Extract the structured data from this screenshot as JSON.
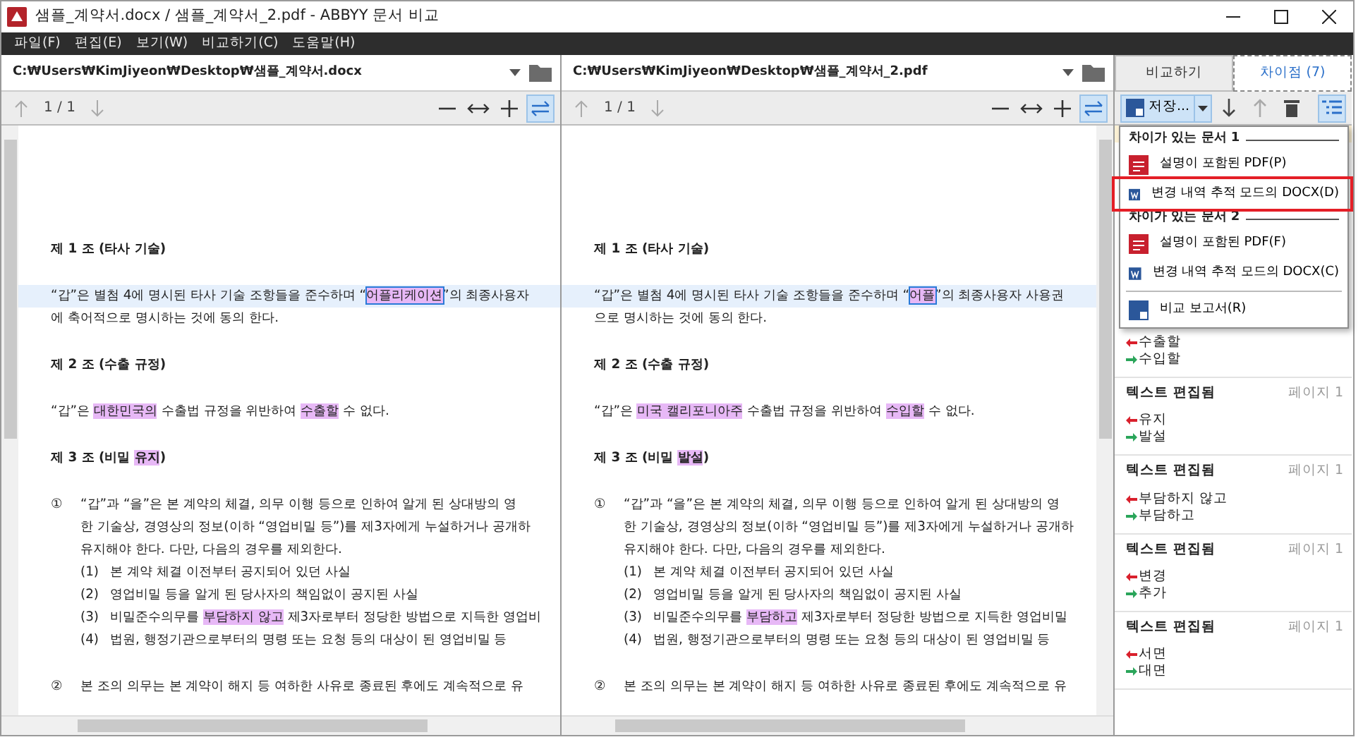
{
  "window": {
    "title": "샘플_계약서.docx / 샘플_계약서_2.pdf - ABBYY 문서 비교"
  },
  "menu": [
    "파일(F)",
    "편집(E)",
    "보기(W)",
    "비교하기(C)",
    "도움말(H)"
  ],
  "documents": [
    {
      "path": "C:₩Users₩KimJiyeon₩Desktop₩샘플_계약서.docx",
      "page": "1 / 1",
      "sync": true,
      "scrollbar_left": true,
      "lines": [
        {
          "kind": "heading",
          "segments": [
            {
              "text": "제 1 조  (타사 기술)"
            }
          ]
        },
        {
          "kind": "para",
          "current": true,
          "segments": [
            {
              "text": "“갑”은 별첨 4에 명시된 타사 기술 조항들을 준수하며 “"
            },
            {
              "text": "어플리케이션",
              "changed": true,
              "focused": true
            },
            {
              "text": "”의 최종사용자"
            }
          ]
        },
        {
          "kind": "cont",
          "segments": [
            {
              "text": "에 축어적으로 명시하는 것에 동의 한다."
            }
          ]
        },
        {
          "kind": "heading",
          "segments": [
            {
              "text": "제 2 조  (수출 규정)"
            }
          ]
        },
        {
          "kind": "para",
          "segments": [
            {
              "text": "“갑”은 "
            },
            {
              "text": "대한민국의",
              "changed": true
            },
            {
              "text": " 수출법 규정을 위반하여 "
            },
            {
              "text": "수출할",
              "changed": true
            },
            {
              "text": " 수 없다."
            }
          ]
        },
        {
          "kind": "heading",
          "segments": [
            {
              "text": "제 3 조  (비밀 "
            },
            {
              "text": "유지",
              "changed": true
            },
            {
              "text": ")"
            }
          ]
        },
        {
          "kind": "item",
          "marker": "①",
          "segments": [
            {
              "text": "“갑”과 “을”은 본 계약의 체결, 의무 이행 등으로 인하여 알게 된 상대방의 영"
            }
          ]
        },
        {
          "kind": "cont",
          "segments": [
            {
              "text": "한 기술상, 경영상의 정보(이하 “영업비밀 등”)를 제3자에게 누설하거나 공개하"
            }
          ]
        },
        {
          "kind": "cont",
          "segments": [
            {
              "text": "유지해야 한다. 다만, 다음의 경우를 제외한다."
            }
          ]
        },
        {
          "kind": "subitem",
          "marker": "(1)",
          "segments": [
            {
              "text": "본 계약 체결 이전부터 공지되어 있던 사실"
            }
          ]
        },
        {
          "kind": "subitem",
          "marker": "(2)",
          "segments": [
            {
              "text": "영업비밀 등을 알게 된 당사자의 책임없이 공지된 사실"
            }
          ]
        },
        {
          "kind": "subitem",
          "marker": "(3)",
          "segments": [
            {
              "text": "비밀준수의무를 "
            },
            {
              "text": "부담하지 않고",
              "changed": true
            },
            {
              "text": " 제3자로부터 정당한 방법으로 지득한 영업비"
            }
          ]
        },
        {
          "kind": "subitem",
          "marker": "(4)",
          "segments": [
            {
              "text": "법원, 행정기관으로부터의 명령 또는 요청 등의 대상이 된 영업비밀 등"
            }
          ]
        },
        {
          "kind": "item",
          "marker": "②",
          "segments": [
            {
              "text": "본 조의 의무는 본 계약이 해지 등 여하한 사유로 종료된 후에도 계속적으로 유"
            }
          ]
        }
      ]
    },
    {
      "path": "C:₩Users₩KimJiyeon₩Desktop₩샘플_계약서_2.pdf",
      "page": "1 / 1",
      "sync": true,
      "scrollbar_left": false,
      "lines": [
        {
          "kind": "heading",
          "segments": [
            {
              "text": "제 1 조  (타사 기술)"
            }
          ]
        },
        {
          "kind": "para",
          "current": true,
          "segments": [
            {
              "text": "“갑”은 별첨 4에 명시된 타사 기술 조항들을 준수하며 “"
            },
            {
              "text": "어플",
              "changed": true,
              "focused": true
            },
            {
              "text": "”의 최종사용자 사용권"
            }
          ]
        },
        {
          "kind": "cont",
          "segments": [
            {
              "text": "으로 명시하는 것에 동의 한다."
            }
          ]
        },
        {
          "kind": "heading",
          "segments": [
            {
              "text": "제 2 조  (수출 규정)"
            }
          ]
        },
        {
          "kind": "para",
          "segments": [
            {
              "text": "“갑”은 "
            },
            {
              "text": "미국 캘리포니아주",
              "changed": true
            },
            {
              "text": " 수출법 규정을 위반하여 "
            },
            {
              "text": "수입할",
              "changed": true
            },
            {
              "text": " 수 없다."
            }
          ]
        },
        {
          "kind": "heading",
          "segments": [
            {
              "text": "제 3 조  (비밀 "
            },
            {
              "text": "발설",
              "changed": true
            },
            {
              "text": ")"
            }
          ]
        },
        {
          "kind": "item",
          "marker": "①",
          "segments": [
            {
              "text": "“갑”과 “을”은 본 계약의 체결, 의무 이행 등으로 인하여 알게 된 상대방의 영"
            }
          ]
        },
        {
          "kind": "cont",
          "segments": [
            {
              "text": "한 기술상, 경영상의 정보(이하 “영업비밀 등”)를 제3자에게 누설하거나 공개하"
            }
          ]
        },
        {
          "kind": "cont",
          "segments": [
            {
              "text": "유지해야 한다. 다만, 다음의 경우를 제외한다."
            }
          ]
        },
        {
          "kind": "subitem",
          "marker": "(1)",
          "segments": [
            {
              "text": "본 계약 체결 이전부터 공지되어 있던 사실"
            }
          ]
        },
        {
          "kind": "subitem",
          "marker": "(2)",
          "segments": [
            {
              "text": "영업비밀 등을 알게 된 당사자의 책임없이 공지된 사실"
            }
          ]
        },
        {
          "kind": "subitem",
          "marker": "(3)",
          "segments": [
            {
              "text": "비밀준수의무를 "
            },
            {
              "text": "부담하고",
              "changed": true
            },
            {
              "text": " 제3자로부터 정당한 방법으로 지득한 영업비밀"
            }
          ]
        },
        {
          "kind": "subitem",
          "marker": "(4)",
          "segments": [
            {
              "text": "법원, 행정기관으로부터의 명령 또는 요청 등의 대상이 된 영업비밀 등"
            }
          ]
        },
        {
          "kind": "item",
          "marker": "②",
          "segments": [
            {
              "text": "본 조의 의무는 본 계약이 해지 등 여하한 사유로 종료된 후에도 계속적으로 유"
            }
          ]
        }
      ]
    }
  ],
  "side_tabs": [
    {
      "label": "비교하기",
      "selected": false
    },
    {
      "label": "차이점 (7)",
      "selected": true
    }
  ],
  "save_button": {
    "label": "저장..."
  },
  "save_menu": [
    {
      "kind": "header",
      "label": "차이가 있는 문서 1"
    },
    {
      "kind": "pdf",
      "label": "설명이 포함된 PDF(P)",
      "outlined": false
    },
    {
      "kind": "docx",
      "label": "변경 내역 추적 모드의 DOCX(D)",
      "outlined": true
    },
    {
      "kind": "header",
      "label": "차이가 있는 문서 2"
    },
    {
      "kind": "pdf",
      "label": "설명이 포함된 PDF(F)",
      "outlined": false
    },
    {
      "kind": "docx",
      "label": "변경 내역 추적 모드의 DOCX(C)",
      "outlined": false
    },
    {
      "kind": "divider"
    },
    {
      "kind": "report",
      "label": "비교 보고서(R)",
      "outlined": false
    }
  ],
  "differences": [
    {
      "selected": true
    },
    {
      "selected": false,
      "old": "수출할",
      "new": "수입할"
    },
    {
      "selected": false,
      "title": "텍스트 편집됨",
      "page": "페이지 1",
      "old": "유지",
      "new": "발설"
    },
    {
      "selected": false,
      "title": "텍스트 편집됨",
      "page": "페이지 1",
      "old": "부담하지 않고",
      "new": "부담하고"
    },
    {
      "selected": false,
      "title": "텍스트 편집됨",
      "page": "페이지 1",
      "old": "변경",
      "new": "추가"
    },
    {
      "selected": false,
      "title": "텍스트 편집됨",
      "page": "페이지 1",
      "old": "서면",
      "new": "대면"
    }
  ]
}
